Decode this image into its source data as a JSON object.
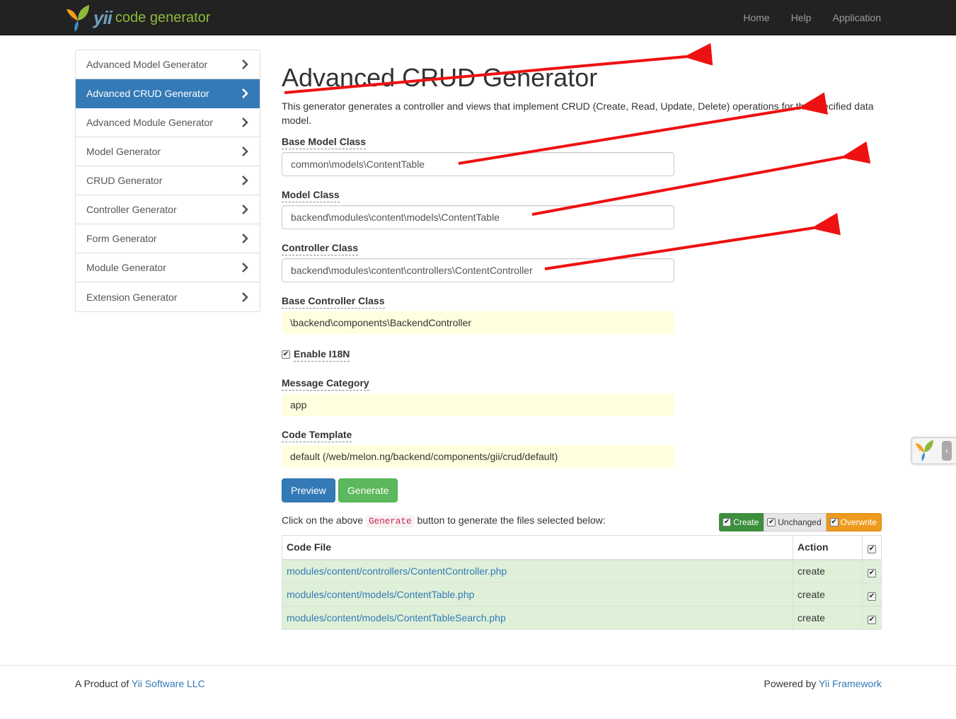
{
  "navbar": {
    "brand_yii": "yii",
    "brand_text": "code generator",
    "links": [
      "Home",
      "Help",
      "Application"
    ]
  },
  "sidebar": {
    "items": [
      {
        "label": "Advanced Model Generator",
        "active": false
      },
      {
        "label": "Advanced CRUD Generator",
        "active": true
      },
      {
        "label": "Advanced Module Generator",
        "active": false
      },
      {
        "label": "Model Generator",
        "active": false
      },
      {
        "label": "CRUD Generator",
        "active": false
      },
      {
        "label": "Controller Generator",
        "active": false
      },
      {
        "label": "Form Generator",
        "active": false
      },
      {
        "label": "Module Generator",
        "active": false
      },
      {
        "label": "Extension Generator",
        "active": false
      }
    ]
  },
  "main": {
    "title": "Advanced CRUD Generator",
    "description": "This generator generates a controller and views that implement CRUD (Create, Read, Update, Delete) operations for the specified data model.",
    "fields": {
      "base_model_class": {
        "label": "Base Model Class",
        "value": "common\\models\\ContentTable"
      },
      "model_class": {
        "label": "Model Class",
        "value": "backend\\modules\\content\\models\\ContentTable"
      },
      "controller_class": {
        "label": "Controller Class",
        "value": "backend\\modules\\content\\controllers\\ContentController"
      },
      "base_controller_class": {
        "label": "Base Controller Class",
        "value": "\\backend\\components\\BackendController"
      },
      "enable_i18n": {
        "label": "Enable I18N",
        "checked": true
      },
      "message_category": {
        "label": "Message Category",
        "value": "app"
      },
      "code_template": {
        "label": "Code Template",
        "value": "default (/web/melon.ng/backend/components/gii/crud/default)"
      }
    },
    "buttons": {
      "preview": "Preview",
      "generate": "Generate"
    },
    "hint": {
      "before": "Click on the above",
      "code": "Generate",
      "after": "button to generate the files selected below:"
    },
    "legend": {
      "create": "Create",
      "unchanged": "Unchanged",
      "overwrite": "Overwrite"
    },
    "table": {
      "headers": {
        "file": "Code File",
        "action": "Action"
      },
      "rows": [
        {
          "file": "modules/content/controllers/ContentController.php",
          "action": "create"
        },
        {
          "file": "modules/content/models/ContentTable.php",
          "action": "create"
        },
        {
          "file": "modules/content/models/ContentTableSearch.php",
          "action": "create"
        }
      ]
    }
  },
  "footer": {
    "left_text": "A Product of",
    "left_link": "Yii Software LLC",
    "right_text": "Powered by",
    "right_link": "Yii Framework"
  },
  "colors": {
    "navbar": "#222222",
    "primary": "#337ab7",
    "success": "#5cb85c",
    "sticky_bg": "#ffffe0",
    "row_success": "#dff0d8",
    "overwrite": "#ee9a1f",
    "annotation_arrow": "#ee1111"
  },
  "icons": {
    "brand": "yii-logo-icon",
    "sidebar_chevron": "chevron-right-icon",
    "debug": "yii-logo-icon",
    "debug_toggle": "chevron-left-icon"
  }
}
